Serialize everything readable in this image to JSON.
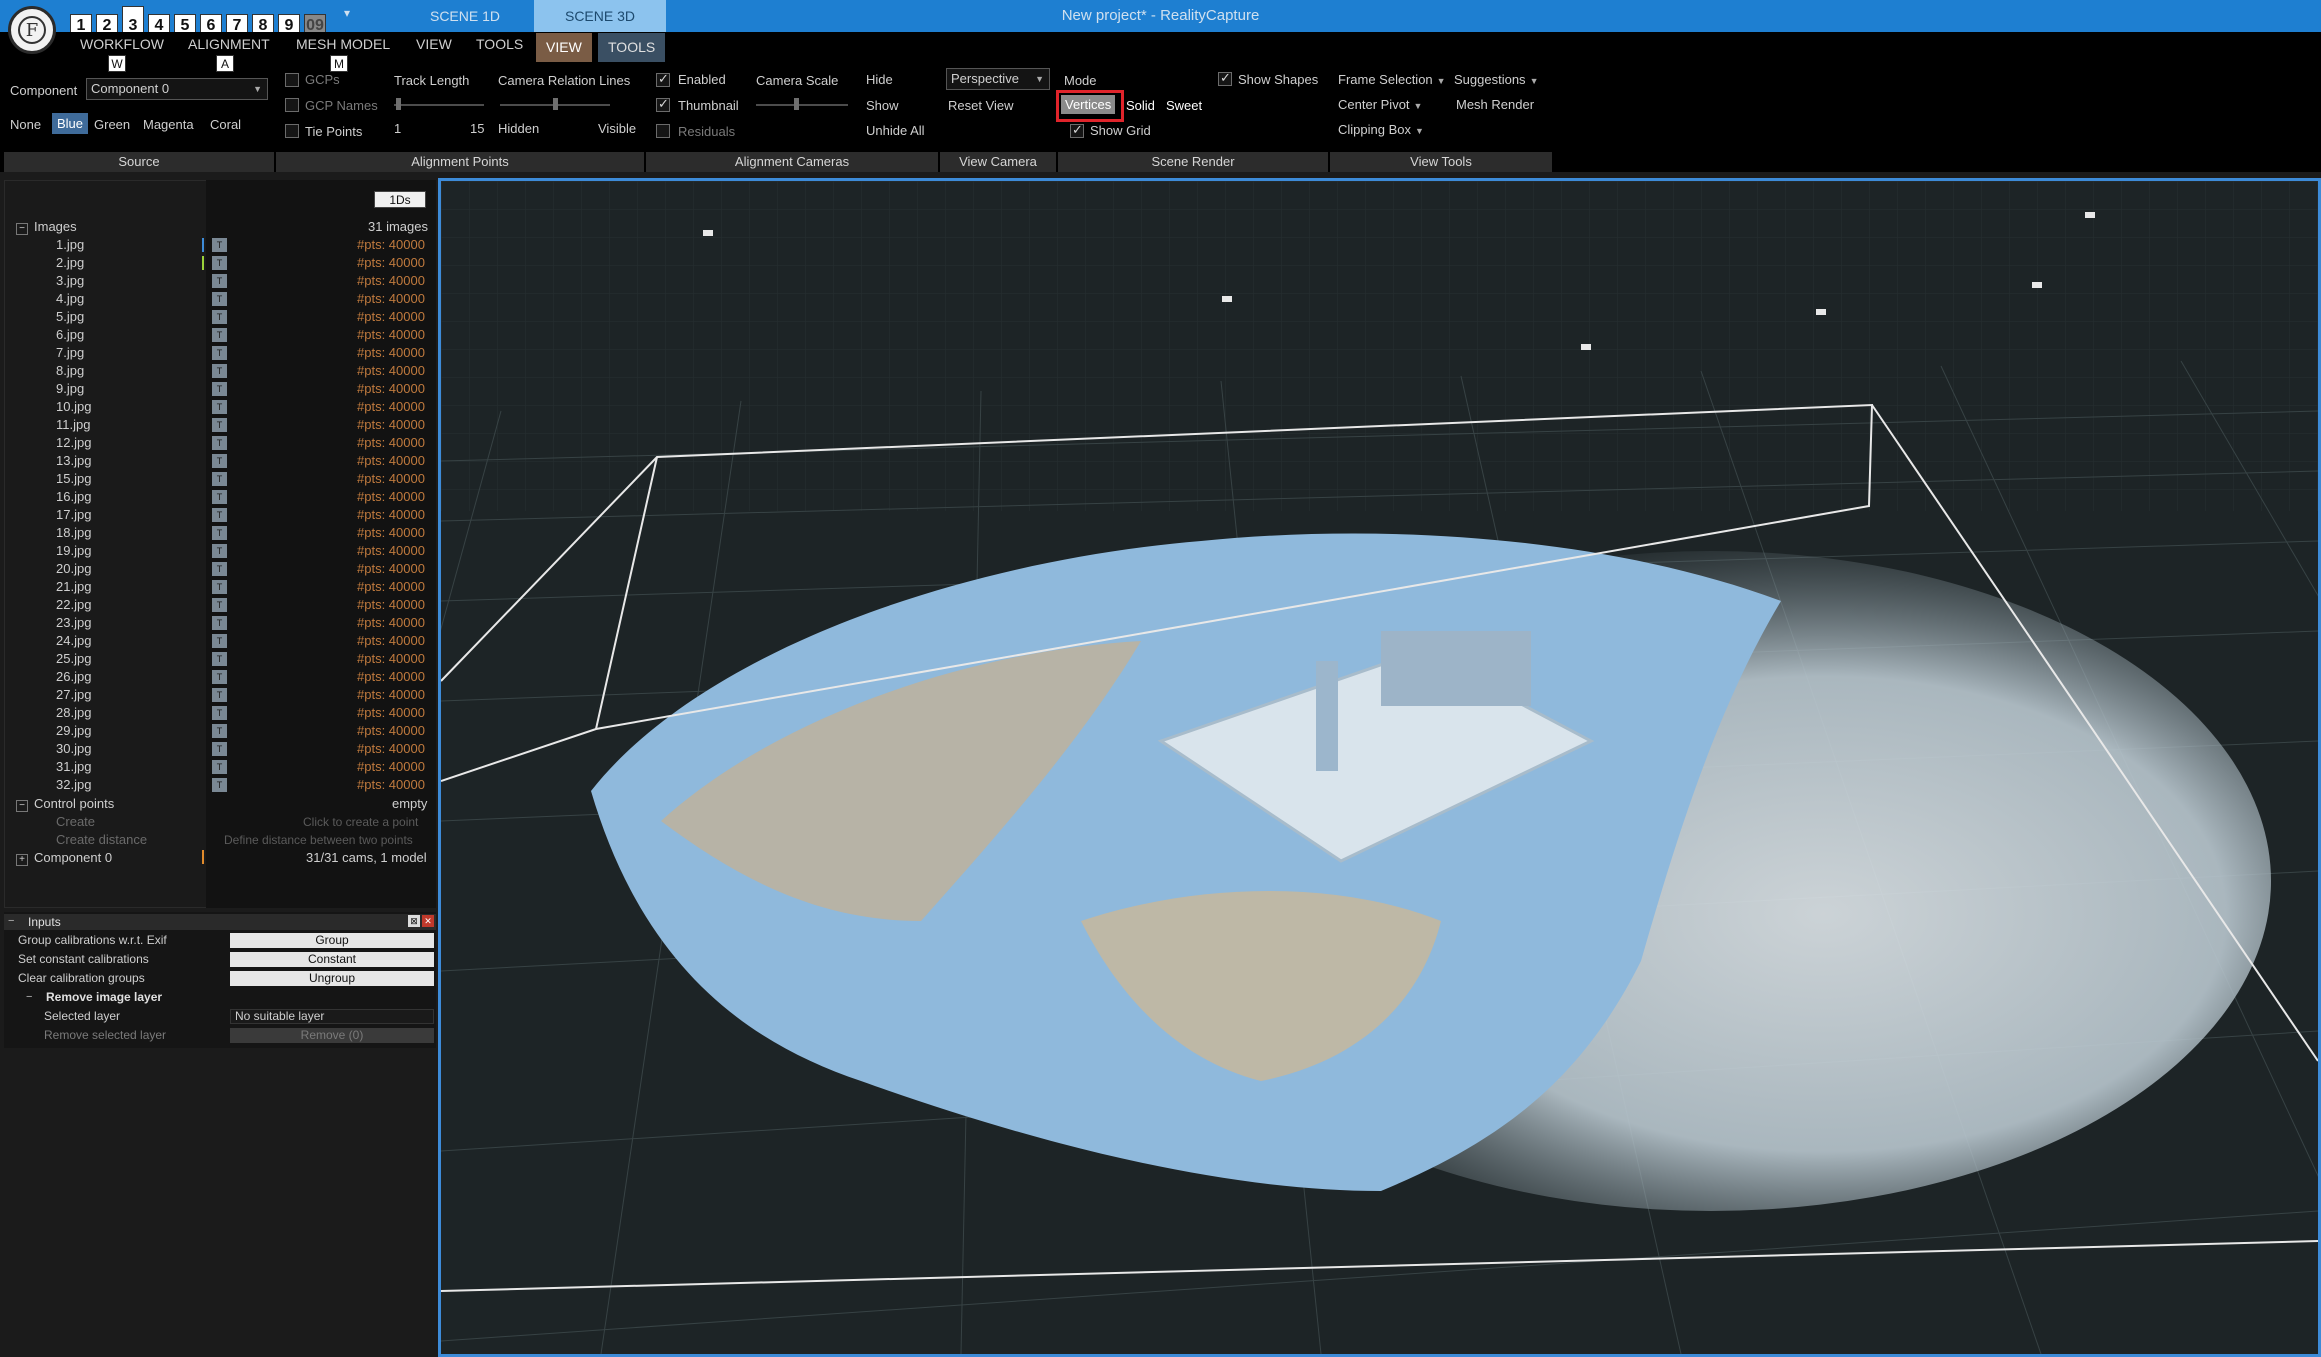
{
  "app": {
    "title": "New project* - RealityCapture",
    "logo_letter": "F",
    "quick_numbers": [
      "1",
      "2",
      "3",
      "4",
      "5",
      "6",
      "7",
      "8",
      "9",
      "09"
    ],
    "scene_tabs": [
      "SCENE 1D",
      "SCENE 3D"
    ]
  },
  "menu": {
    "items": [
      "WORKFLOW",
      "ALIGNMENT",
      "MESH MODEL",
      "VIEW",
      "TOOLS",
      "VIEW",
      "TOOLS"
    ],
    "keys": [
      "W",
      "A",
      "M"
    ]
  },
  "ribbon": {
    "source": {
      "component_label": "Component",
      "component_value": "Component 0",
      "colors": [
        "None",
        "Blue",
        "Green",
        "Magenta",
        "Coral"
      ],
      "group_label": "Source"
    },
    "alignment_points": {
      "checks": [
        "GCPs",
        "GCP Names",
        "Tie Points"
      ],
      "track_length_label": "Track Length",
      "track_min": "1",
      "track_max": "15",
      "camera_relation_label": "Camera Relation Lines",
      "hidden_label": "Hidden",
      "visible_label": "Visible",
      "group_label": "Alignment Points"
    },
    "alignment_cameras": {
      "checks": [
        "Enabled",
        "Thumbnail",
        "Residuals"
      ],
      "camera_scale_label": "Camera Scale",
      "hide": "Hide",
      "show": "Show",
      "unhide_all": "Unhide All",
      "group_label": "Alignment Cameras"
    },
    "view_camera": {
      "projection": "Perspective",
      "reset_view": "Reset View",
      "group_label": "View Camera"
    },
    "scene_render": {
      "mode_label": "Mode",
      "modes": [
        "Vertices",
        "Solid",
        "Sweet"
      ],
      "show_grid": "Show Grid",
      "show_shapes": "Show Shapes",
      "group_label": "Scene Render"
    },
    "view_tools": {
      "frame_selection": "Frame Selection",
      "suggestions": "Suggestions",
      "center_pivot": "Center Pivot",
      "mesh_render": "Mesh Render",
      "clipping_box": "Clipping Box",
      "group_label": "View Tools"
    }
  },
  "tree": {
    "header_button": "1Ds",
    "images_label": "Images",
    "images_count": "31 images",
    "image_files": [
      "1.jpg",
      "2.jpg",
      "3.jpg",
      "4.jpg",
      "5.jpg",
      "6.jpg",
      "7.jpg",
      "8.jpg",
      "9.jpg",
      "10.jpg",
      "11.jpg",
      "12.jpg",
      "13.jpg",
      "15.jpg",
      "16.jpg",
      "17.jpg",
      "18.jpg",
      "19.jpg",
      "20.jpg",
      "21.jpg",
      "22.jpg",
      "23.jpg",
      "24.jpg",
      "25.jpg",
      "26.jpg",
      "27.jpg",
      "28.jpg",
      "29.jpg",
      "30.jpg",
      "31.jpg",
      "32.jpg"
    ],
    "pts_label": "#pts: 40000",
    "control_points": "Control points",
    "control_points_value": "empty",
    "create": "Create",
    "create_hint": "Click to create a point",
    "create_distance": "Create distance",
    "create_distance_hint": "Define distance between two points",
    "component": "Component 0",
    "component_value": "31/31 cams, 1 model"
  },
  "inputs": {
    "title": "Inputs",
    "rows": [
      {
        "label": "Group calibrations w.r.t. Exif",
        "value": "Group"
      },
      {
        "label": "Set constant calibrations",
        "value": "Constant"
      },
      {
        "label": "Clear calibration groups",
        "value": "Ungroup"
      }
    ],
    "section": "Remove image layer",
    "selected_layer_label": "Selected layer",
    "selected_layer_value": "No suitable layer",
    "remove_selected_label": "Remove selected layer",
    "remove_button": "Remove (0)"
  },
  "colors": {
    "titlebar": "#1e7fd1",
    "accent_selected": "#3d8bd8",
    "highlight_box": "#e0242b",
    "model_blue": "#8fc0ea",
    "model_tan": "#c9b08a"
  }
}
